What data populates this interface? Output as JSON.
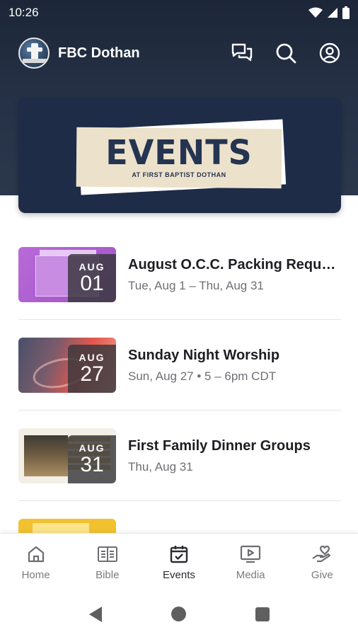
{
  "status": {
    "time": "10:26"
  },
  "appbar": {
    "title": "FBC Dothan"
  },
  "banner": {
    "title": "EVENTS",
    "subtitle": "AT FIRST BAPTIST DOTHAN"
  },
  "events": [
    {
      "month": "AUG",
      "day": "01",
      "title": "August O.C.C. Packing Requ…",
      "date": "Tue, Aug 1 – Thu, Aug 31"
    },
    {
      "month": "AUG",
      "day": "27",
      "title": "Sunday Night Worship",
      "date": "Sun, Aug 27 • 5 – 6pm CDT"
    },
    {
      "month": "AUG",
      "day": "31",
      "title": "First Family Dinner Groups",
      "date": "Thu, Aug 31"
    }
  ],
  "nav": [
    {
      "label": "Home",
      "icon": "home-icon"
    },
    {
      "label": "Bible",
      "icon": "bible-icon"
    },
    {
      "label": "Events",
      "icon": "calendar-icon"
    },
    {
      "label": "Media",
      "icon": "media-icon"
    },
    {
      "label": "Give",
      "icon": "give-icon"
    }
  ],
  "colors": {
    "header": "#263247",
    "banner": "#1f2c48",
    "banner_paper": "#ece2cc",
    "active_nav": "#2b2b30"
  }
}
